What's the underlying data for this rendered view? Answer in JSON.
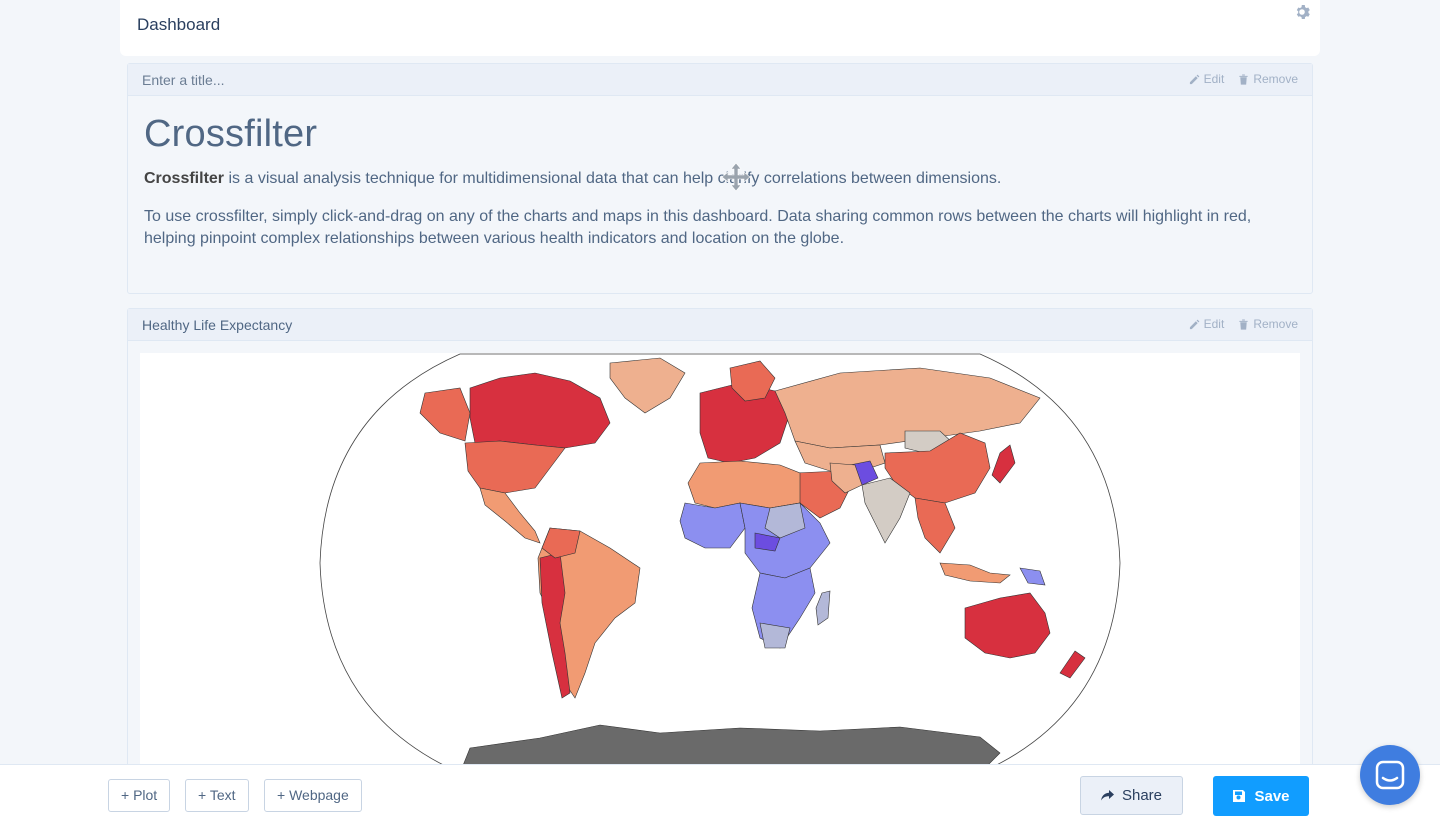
{
  "header": {
    "title": "Dashboard",
    "settings_icon": "gear-icon"
  },
  "text_panel": {
    "title_placeholder": "Enter a title...",
    "edit_label": "Edit",
    "remove_label": "Remove",
    "heading": "Crossfilter",
    "para1_bold": "Crossfilter",
    "para1_rest": " is a visual analysis technique for multidimensional data that can help clarify correlations between dimensions.",
    "para2": "To use crossfilter, simply click-and-drag on any of the charts and maps in this dashboard. Data sharing common rows between the charts will highlight in red, helping pinpoint complex relationships between various health indicators and location on the globe."
  },
  "map_panel": {
    "title": "Healthy Life Expectancy",
    "edit_label": "Edit",
    "remove_label": "Remove",
    "colors": {
      "high": "#d7303f",
      "mid_high": "#e96a55",
      "mid": "#f19b73",
      "low_mid": "#eeb08f",
      "neutral": "#d3ccc5",
      "low": "#8c8ff0",
      "very_low": "#6c4de0",
      "no_data": "#6a6a6a",
      "grey_blue": "#b3b8d8"
    }
  },
  "toolbar": {
    "add_plot": "+ Plot",
    "add_text": "+ Text",
    "add_webpage": "+ Webpage",
    "share": "Share",
    "save": "Save"
  },
  "colors": {
    "accent": "#119dff",
    "chat": "#3f7de0"
  }
}
